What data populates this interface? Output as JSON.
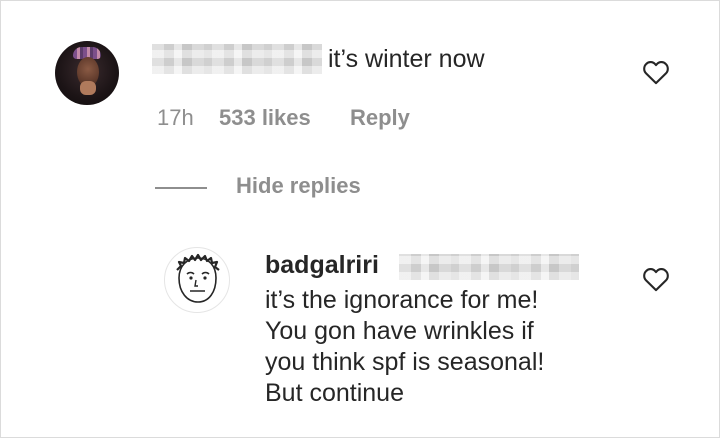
{
  "comment": {
    "text": "it’s winter now",
    "time": "17h",
    "likes": "533 likes",
    "reply_label": "Reply"
  },
  "replies_toggle": {
    "label": "Hide replies"
  },
  "reply": {
    "username": "badgalriri",
    "lines": [
      "it’s the ignorance for me!",
      "You gon have wrinkles if",
      "you think spf is seasonal!",
      "But continue"
    ]
  },
  "icons": {
    "like": "heart-outline-icon"
  }
}
